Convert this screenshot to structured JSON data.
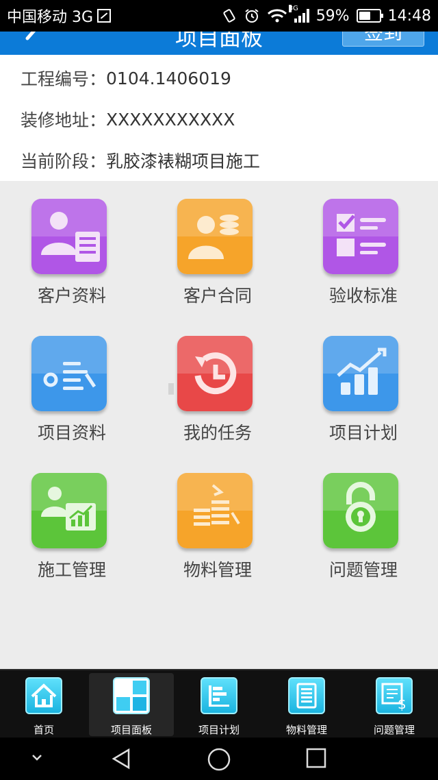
{
  "status_bar": {
    "carrier": "中国移动 3G",
    "network": "3G",
    "battery": "59%",
    "battery_level": 0.59,
    "time": "14:48"
  },
  "header": {
    "title": "项目面板",
    "signin_label": "签到",
    "color": "#0c7bd8"
  },
  "info": {
    "project_no_label": "工程编号：",
    "project_no": "0104.1406019",
    "address_label": "装修地址：",
    "address": "XXXXXXXXXXX",
    "stage_label": "当前阶段：",
    "stage": "乳胶漆裱糊项目施工"
  },
  "grid": {
    "items": [
      {
        "label": "客户资料",
        "icon": "customer-info-icon",
        "color": "#b056e6"
      },
      {
        "label": "客户合同",
        "icon": "customer-contract-icon",
        "color": "#f6a42a"
      },
      {
        "label": "验收标准",
        "icon": "acceptance-standard-icon",
        "color": "#b056e6"
      },
      {
        "label": "项目资料",
        "icon": "project-info-icon",
        "color": "#3d97ea"
      },
      {
        "label": "我的任务",
        "icon": "my-tasks-icon",
        "color": "#e84848"
      },
      {
        "label": "项目计划",
        "icon": "project-plan-icon",
        "color": "#3d97ea"
      },
      {
        "label": "施工管理",
        "icon": "construction-management-icon",
        "color": "#5cc53a"
      },
      {
        "label": "物料管理",
        "icon": "material-management-icon",
        "color": "#f6a42a"
      },
      {
        "label": "问题管理",
        "icon": "issue-management-icon",
        "color": "#5cc53a"
      }
    ]
  },
  "bottom_nav": {
    "items": [
      {
        "label": "首页",
        "icon": "home-icon"
      },
      {
        "label": "项目面板",
        "icon": "project-panel-icon"
      },
      {
        "label": "项目计划",
        "icon": "project-plan-nav-icon"
      },
      {
        "label": "物料管理",
        "icon": "material-nav-icon"
      },
      {
        "label": "问题管理",
        "icon": "issue-nav-icon"
      }
    ],
    "active_index": 1
  }
}
